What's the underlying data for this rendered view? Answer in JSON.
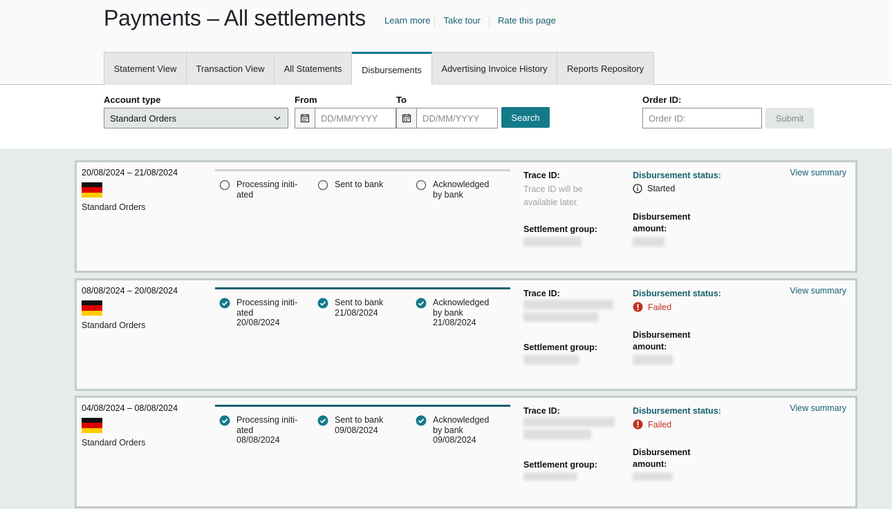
{
  "header": {
    "title": "Payments – All settlements",
    "links": [
      "Learn more",
      "Take tour",
      "Rate this page"
    ]
  },
  "tabs": [
    {
      "label": "Statement View",
      "active": false
    },
    {
      "label": "Transaction View",
      "active": false
    },
    {
      "label": "All Statements",
      "active": false
    },
    {
      "label": "Disbursements",
      "active": true
    },
    {
      "label": "Advertising Invoice History",
      "active": false
    },
    {
      "label": "Reports Repository",
      "active": false
    }
  ],
  "filters": {
    "account_type_label": "Account type",
    "account_type_value": "Standard Orders",
    "from_label": "From",
    "to_label": "To",
    "date_placeholder": "DD/MM/YYYY",
    "search_label": "Search",
    "order_id_label": "Order ID:",
    "order_id_placeholder": "Order ID:",
    "submit_label": "Submit"
  },
  "colors": {
    "accent": "#137a8a",
    "link": "#16606e",
    "failed": "#c0321f"
  },
  "cards": [
    {
      "period": "20/08/2024 – 21/08/2024",
      "order_type": "Standard Orders",
      "steps": [
        {
          "label": "Processing initi-\nated",
          "date": "",
          "done": false
        },
        {
          "label": "Sent to bank",
          "date": "",
          "done": false
        },
        {
          "label": "Acknowledged\nby bank",
          "date": "",
          "done": false
        }
      ],
      "trace_label": "Trace ID:",
      "trace_note": "Trace ID will be available later.",
      "settlement_label": "Settlement group:",
      "status_label": "Disbursement status:",
      "status": "Started",
      "amount_label": "Disbursement amount:",
      "view_summary": "View summary"
    },
    {
      "period": "08/08/2024 – 20/08/2024",
      "order_type": "Standard Orders",
      "steps": [
        {
          "label": "Processing initi-\nated",
          "date": "20/08/2024",
          "done": true
        },
        {
          "label": "Sent to bank",
          "date": "21/08/2024",
          "done": true
        },
        {
          "label": "Acknowledged\nby bank",
          "date": "21/08/2024",
          "done": true
        }
      ],
      "trace_label": "Trace ID:",
      "trace_note": "",
      "settlement_label": "Settlement group:",
      "status_label": "Disbursement status:",
      "status": "Failed",
      "amount_label": "Disbursement amount:",
      "view_summary": "View summary"
    },
    {
      "period": "04/08/2024 – 08/08/2024",
      "order_type": "Standard Orders",
      "steps": [
        {
          "label": "Processing initi-\nated",
          "date": "08/08/2024",
          "done": true
        },
        {
          "label": "Sent to bank",
          "date": "09/08/2024",
          "done": true
        },
        {
          "label": "Acknowledged\nby bank",
          "date": "09/08/2024",
          "done": true
        }
      ],
      "trace_label": "Trace ID:",
      "trace_note": "",
      "settlement_label": "Settlement group:",
      "status_label": "Disbursement status:",
      "status": "Failed",
      "amount_label": "Disbursement amount:",
      "view_summary": "View summary"
    }
  ]
}
